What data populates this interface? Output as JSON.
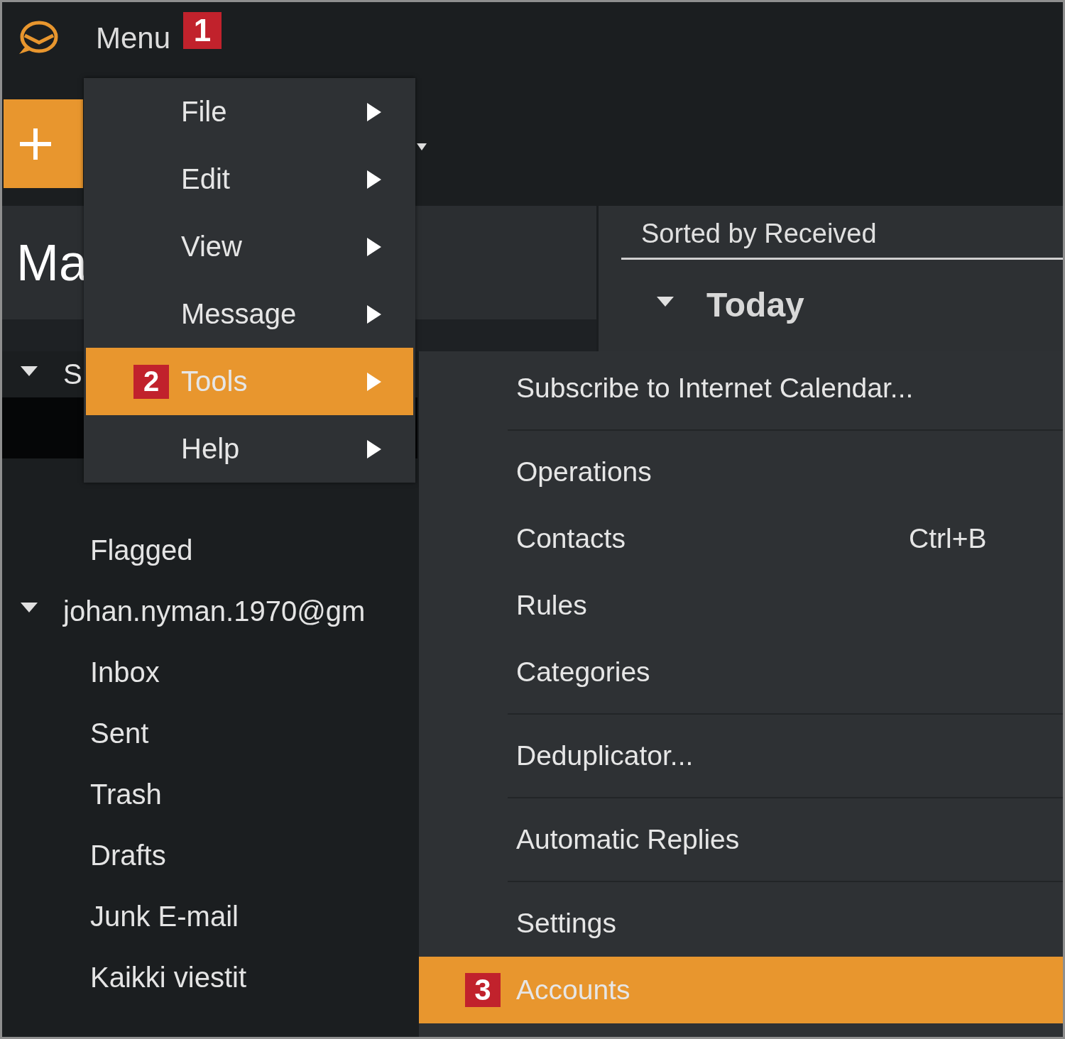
{
  "header": {
    "menu_button": {
      "label": "Menu",
      "badge": "1"
    }
  },
  "sidebar": {
    "heading": "Ma",
    "tree": [
      {
        "label": "S",
        "expanded": true,
        "children": [
          {
            "selected": true
          },
          {
            "selected": false
          },
          {
            "label": "Flagged",
            "selected": false
          }
        ]
      },
      {
        "label": "johan.nyman.1970@gm",
        "expanded": true,
        "children": [
          {
            "label": "Inbox",
            "selected": false
          },
          {
            "label": "Sent",
            "selected": false
          },
          {
            "label": "Trash",
            "selected": false
          },
          {
            "label": "Drafts",
            "selected": false
          },
          {
            "label": "Junk E-mail",
            "selected": false
          },
          {
            "label": "Kaikki viestit",
            "selected": false
          }
        ]
      }
    ]
  },
  "message_list": {
    "sort_label": "Sorted by Received",
    "groups": [
      {
        "label": "Today",
        "expanded": true
      }
    ]
  },
  "main_menu": {
    "items": [
      {
        "label": "File",
        "selected": false
      },
      {
        "label": "Edit",
        "selected": false
      },
      {
        "label": "View",
        "selected": false
      },
      {
        "label": "Message",
        "selected": false
      },
      {
        "label": "Tools",
        "selected": true,
        "badge": "2"
      },
      {
        "label": "Help",
        "selected": false
      }
    ]
  },
  "tools_submenu": {
    "items": [
      {
        "kind": "item",
        "label": "Subscribe to Internet Calendar...",
        "selected": false
      },
      {
        "kind": "separator"
      },
      {
        "kind": "item",
        "label": "Operations",
        "selected": false
      },
      {
        "kind": "item",
        "label": "Contacts",
        "shortcut": "Ctrl+B",
        "selected": false
      },
      {
        "kind": "item",
        "label": "Rules",
        "selected": false
      },
      {
        "kind": "item",
        "label": "Categories",
        "selected": false
      },
      {
        "kind": "separator"
      },
      {
        "kind": "item",
        "label": "Deduplicator...",
        "selected": false
      },
      {
        "kind": "separator"
      },
      {
        "kind": "item",
        "label": "Automatic Replies",
        "selected": false
      },
      {
        "kind": "separator"
      },
      {
        "kind": "item",
        "label": "Settings",
        "selected": false
      },
      {
        "kind": "item",
        "label": "Accounts",
        "selected": true,
        "badge": "3"
      }
    ]
  }
}
